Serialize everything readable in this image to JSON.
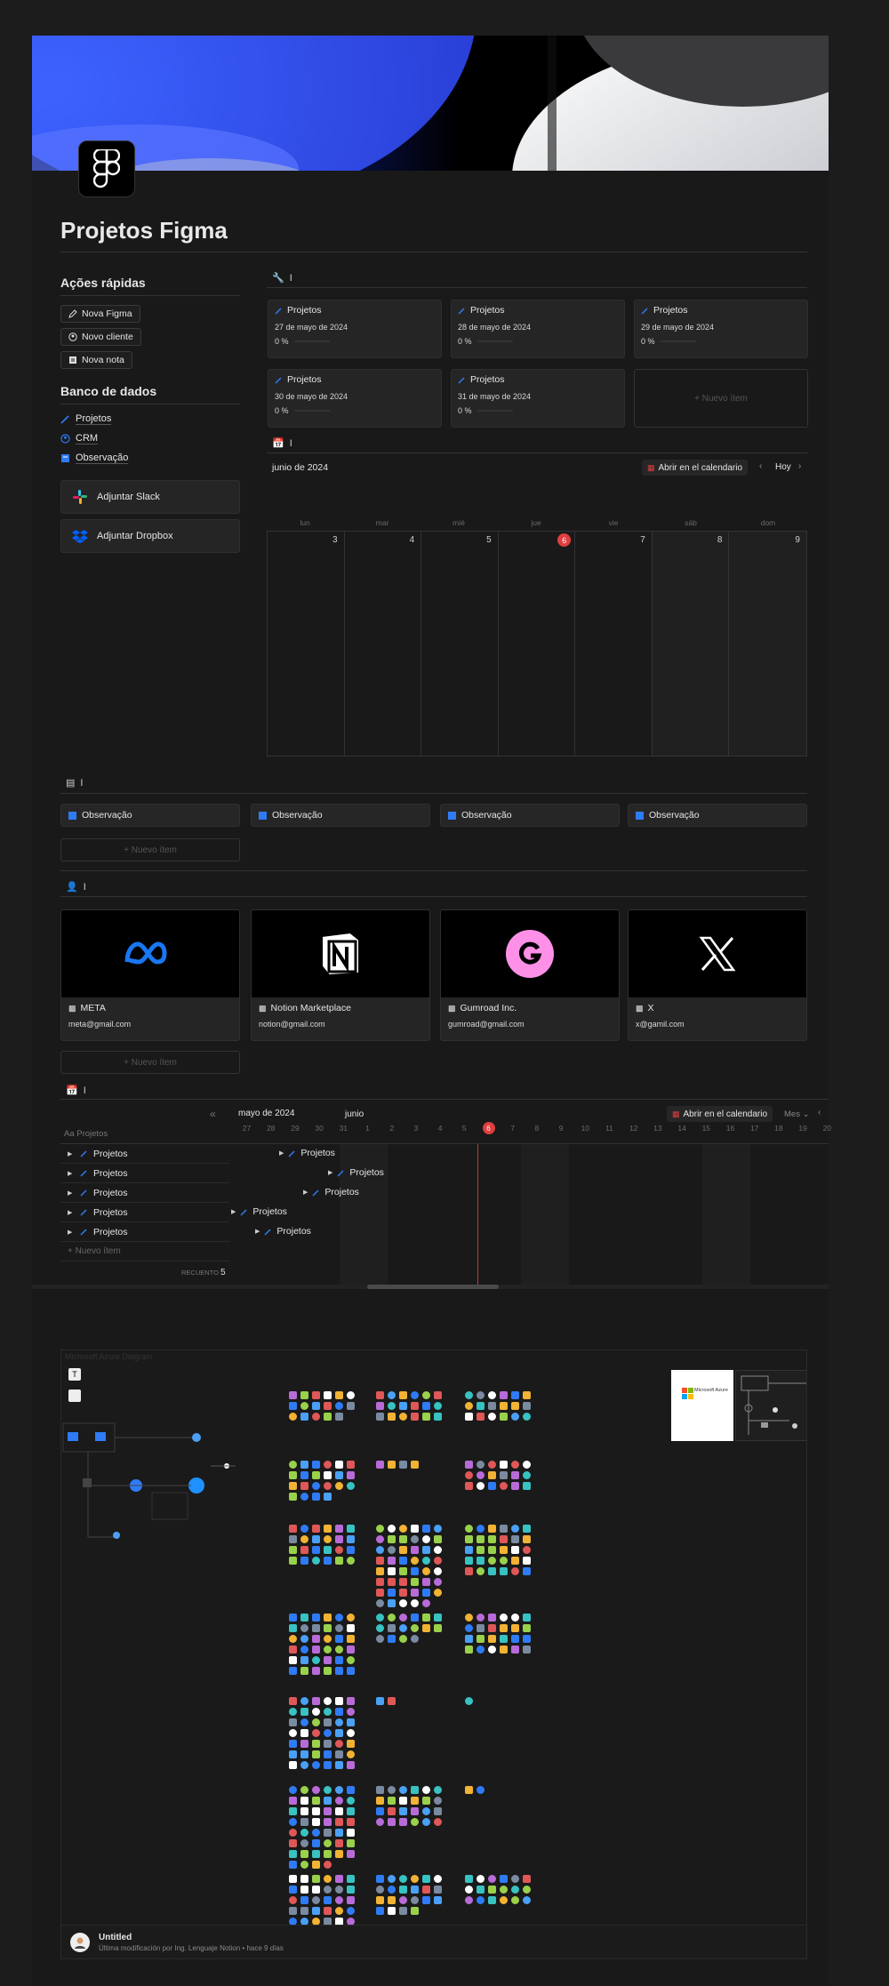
{
  "page": {
    "title": "Projetos Figma"
  },
  "quick_actions": {
    "heading": "Ações rápidas",
    "buttons": [
      "Nova Figma",
      "Novo cliente",
      "Nova nota"
    ]
  },
  "database": {
    "heading": "Banco de dados",
    "links": [
      "Projetos",
      "CRM",
      "Observação"
    ]
  },
  "integrations": [
    "Adjuntar Slack",
    "Adjuntar Dropbox"
  ],
  "gallery_projects": {
    "view_title": "I",
    "cards": [
      {
        "name": "Projetos",
        "date": "27 de mayo de 2024",
        "progress": "0 %"
      },
      {
        "name": "Projetos",
        "date": "28 de mayo de 2024",
        "progress": "0 %"
      },
      {
        "name": "Projetos",
        "date": "29 de mayo de 2024",
        "progress": "0 %"
      },
      {
        "name": "Projetos",
        "date": "30 de mayo de 2024",
        "progress": "0 %"
      },
      {
        "name": "Projetos",
        "date": "31 de mayo de 2024",
        "progress": "0 %"
      }
    ],
    "new_item": "+ Nuevo ítem"
  },
  "calendar": {
    "view_title": "I",
    "month": "junio de 2024",
    "open_button": "Abrir en el calendario",
    "today_button": "Hoy",
    "days_of_week": [
      "lun",
      "mar",
      "mié",
      "jue",
      "vie",
      "sáb",
      "dom"
    ],
    "dates": [
      "3",
      "4",
      "5",
      "6",
      "7",
      "8",
      "9"
    ],
    "today": "6"
  },
  "notes": {
    "view_title": "I",
    "items": [
      "Observação",
      "Observação",
      "Observação",
      "Observação"
    ],
    "new_item": "+ Nuevo ítem"
  },
  "crm": {
    "view_title": "I",
    "cards": [
      {
        "name": "META",
        "email": "meta@gmail.com"
      },
      {
        "name": "Notion Marketplace",
        "email": "notion@gmail.com"
      },
      {
        "name": "Gumroad Inc.",
        "email": "gumroad@gmail.com"
      },
      {
        "name": "X",
        "email": "x@gamil.com"
      }
    ],
    "new_item": "+ Nuevo ítem"
  },
  "timeline": {
    "view_title": "I",
    "collapse_icon": "«",
    "month_left": "mayo de 2024",
    "month_right": "junio",
    "open_button": "Abrir en el calendario",
    "scale": "Mes",
    "header": "Aa Projetos",
    "rows": [
      "Projetos",
      "Projetos",
      "Projetos",
      "Projetos",
      "Projetos"
    ],
    "new_item": "+ Nuevo ítem",
    "count_label": "RECUENTO",
    "count": "5",
    "ticks": [
      "27",
      "28",
      "29",
      "30",
      "31",
      "1",
      "2",
      "3",
      "4",
      "5",
      "6",
      "7",
      "8",
      "9",
      "10",
      "11",
      "12",
      "13",
      "14",
      "15",
      "16",
      "17",
      "18",
      "19",
      "20"
    ],
    "today": "6",
    "bar_labels": [
      "Projetos",
      "Projetos",
      "Projetos",
      "Projetos",
      "Projetos"
    ]
  },
  "embed": {
    "title": "Microsoft Azure Diagram",
    "thumb_brand": "Microsoft Azure",
    "footer_title": "Untitled",
    "footer_meta": "Última modificación por Ing. Lenguaje Notion • hace 9 días"
  },
  "colors": {
    "accent": "#2f7bf5",
    "today": "#e03e3e",
    "background": "#191919"
  }
}
